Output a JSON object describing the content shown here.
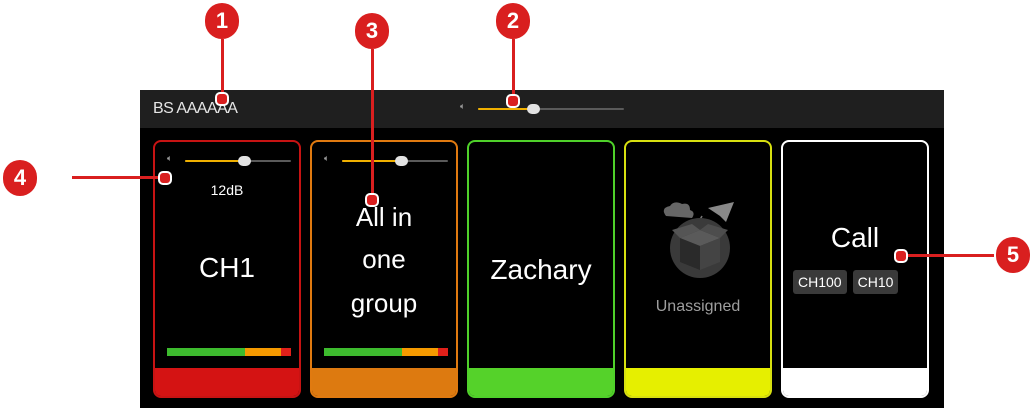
{
  "header": {
    "device_name": "BS AAAAAA"
  },
  "master_volume": {
    "level": 0.38
  },
  "channels": [
    {
      "label": "CH1",
      "db": "12dB",
      "volume": 0.56,
      "border": "#c71313",
      "bottom": "#d41313",
      "meter": [
        0.63,
        0.29,
        0.08
      ]
    },
    {
      "label_lines": [
        "All in",
        "one",
        "group"
      ],
      "volume": 0.56,
      "border": "#e07a10",
      "bottom": "#dd7a10",
      "meter": [
        0.63,
        0.29,
        0.08
      ]
    },
    {
      "label": "Zachary",
      "border": "#4fd12a",
      "bottom": "#55d22a"
    },
    {
      "label": "Unassigned",
      "border": "#d8e010",
      "bottom": "#e6ef00"
    },
    {
      "label": "Call",
      "tags": [
        "CH100",
        "CH10"
      ],
      "border": "#ffffff",
      "bottom": "#ffffff"
    }
  ],
  "callouts": [
    "1",
    "2",
    "3",
    "4",
    "5"
  ],
  "colors": {
    "callout": "#d91f1f",
    "accent": "#f0b000"
  }
}
